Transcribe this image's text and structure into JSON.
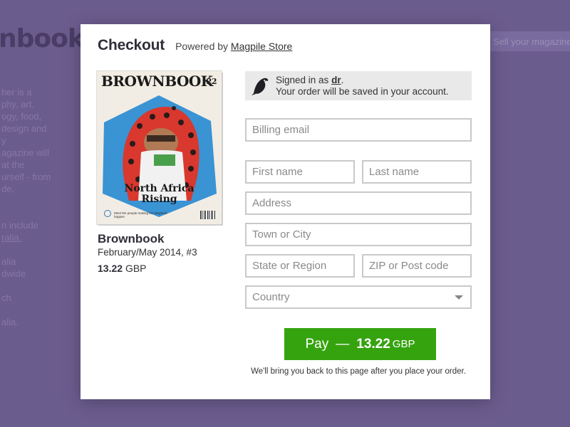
{
  "background": {
    "site_title": "nbook",
    "text_lines": [
      "her is a",
      "phy, art,",
      "ogy, food,",
      "design and",
      "y",
      "agazine will",
      "at the",
      "urself - from",
      "de."
    ],
    "text_lines_2": [
      "n include",
      "ralia."
    ],
    "text_lines_3": [
      "alia",
      "dwide"
    ],
    "text_lines_4": [
      "ch"
    ],
    "text_lines_5": [
      "alia."
    ],
    "sell_button": "Sell your magazine"
  },
  "checkout": {
    "title": "Checkout",
    "powered_prefix": "Powered by",
    "store_link": "Magpile Store"
  },
  "product": {
    "cover": {
      "masthead": "BROWNBOOK",
      "issue_number": "22",
      "headline_line1": "North Africa",
      "headline_line2": "Rising",
      "foot_text": "Meet the people making the Maghreb happen"
    },
    "name": "Brownbook",
    "issue": "February/May 2014, #3",
    "price_amount": "13.22",
    "price_currency": "GBP"
  },
  "signin": {
    "prefix": "Signed in as",
    "username": "dr",
    "suffix": ".",
    "message": "Your order will be saved in your account."
  },
  "form": {
    "billing_email_placeholder": "Billing email",
    "first_name_placeholder": "First name",
    "last_name_placeholder": "Last name",
    "address_placeholder": "Address",
    "town_placeholder": "Town or City",
    "state_placeholder": "State or Region",
    "zip_placeholder": "ZIP or Post code",
    "country_label": "Country"
  },
  "pay_button": {
    "label": "Pay",
    "dash": "—",
    "amount": "13.22",
    "currency": "GBP"
  },
  "footer_note": "We'll bring you back to this page after you place your order.",
  "colors": {
    "pay_green": "#35a30e",
    "backdrop_purple": "#6f6092",
    "signin_bg": "#e9e9e9"
  }
}
